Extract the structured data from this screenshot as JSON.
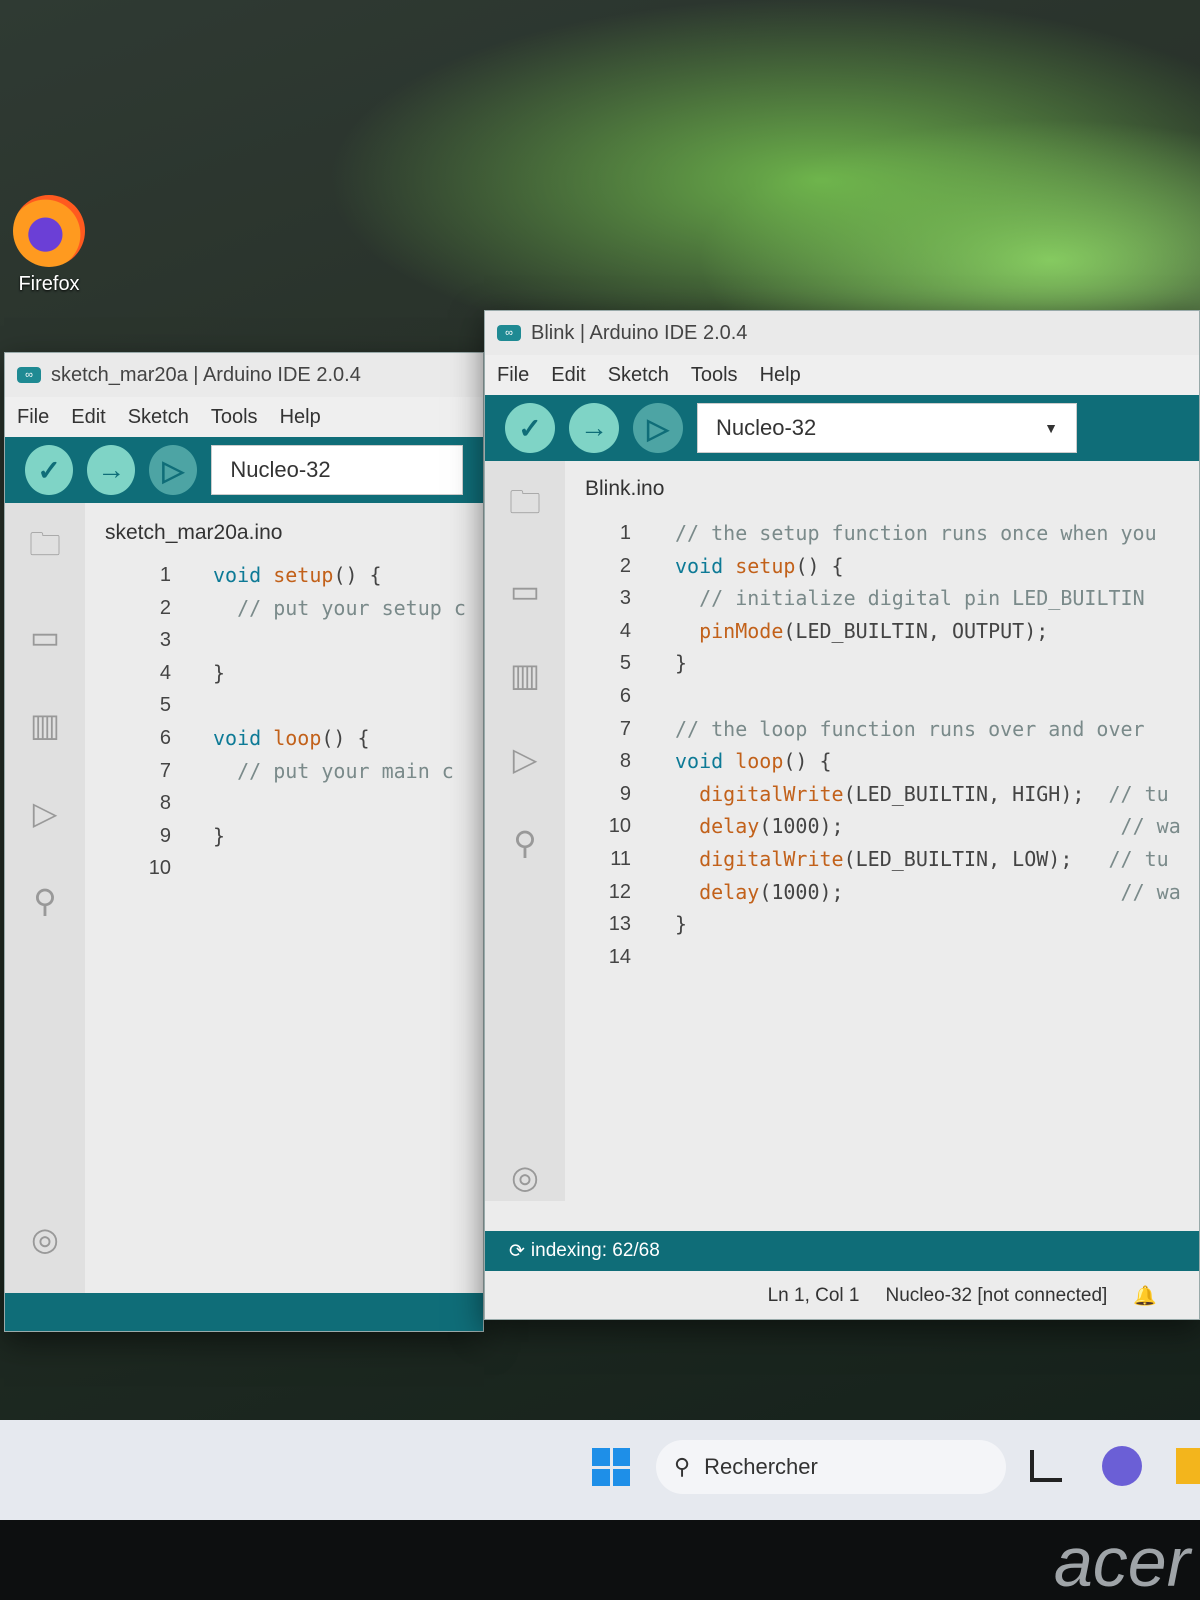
{
  "desktop": {
    "icons": [
      {
        "label": "Firefox"
      }
    ]
  },
  "window_back": {
    "title": "sketch_mar20a | Arduino IDE 2.0.4",
    "menu": [
      "File",
      "Edit",
      "Sketch",
      "Tools",
      "Help"
    ],
    "board": "Nucleo-32",
    "tab": "sketch_mar20a.ino",
    "line_numbers": [
      "1",
      "2",
      "3",
      "4",
      "5",
      "6",
      "7",
      "8",
      "9",
      "10"
    ],
    "code": [
      [
        "void ",
        "setup",
        "() {"
      ],
      [
        "  // put your setup c"
      ],
      [
        ""
      ],
      [
        "}"
      ],
      [
        ""
      ],
      [
        "void ",
        "loop",
        "() {"
      ],
      [
        "  // put your main c"
      ],
      [
        ""
      ],
      [
        "}"
      ],
      [
        ""
      ]
    ]
  },
  "window_front": {
    "title": "Blink | Arduino IDE 2.0.4",
    "menu": [
      "File",
      "Edit",
      "Sketch",
      "Tools",
      "Help"
    ],
    "board": "Nucleo-32",
    "tab": "Blink.ino",
    "line_numbers": [
      "1",
      "2",
      "3",
      "4",
      "5",
      "6",
      "7",
      "8",
      "9",
      "10",
      "11",
      "12",
      "13",
      "14"
    ],
    "code_lines": [
      "// the setup function runs once when you",
      "void setup() {",
      "  // initialize digital pin LED_BUILTIN",
      "  pinMode(LED_BUILTIN, OUTPUT);",
      "}",
      "",
      "// the loop function runs over and over",
      "void loop() {",
      "  digitalWrite(LED_BUILTIN, HIGH);  // tu",
      "  delay(1000);                       // wa",
      "  digitalWrite(LED_BUILTIN, LOW);   // tu",
      "  delay(1000);                       // wa",
      "}",
      ""
    ],
    "indexing": "indexing: 62/68",
    "cursor_pos": "Ln 1, Col 1",
    "board_status": "Nucleo-32 [not connected]"
  },
  "taskbar": {
    "search_placeholder": "Rechercher"
  },
  "brand": "acer",
  "colors": {
    "toolbar": "#0f6d78",
    "button": "#7fd4c6",
    "keyword": "#0d7a96",
    "function": "#c2611a"
  }
}
